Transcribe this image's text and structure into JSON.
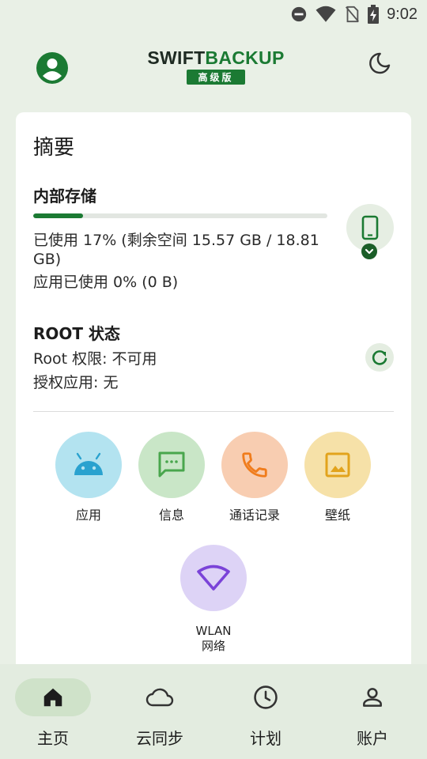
{
  "status_bar": {
    "time": "9:02",
    "icons": [
      "do-not-disturb-icon",
      "wifi-icon",
      "no-sim-icon",
      "battery-charging-icon"
    ]
  },
  "header": {
    "brand_part1": "SWIFT",
    "brand_part2": "BACKUP",
    "badge": "高级版",
    "left_icon": "account-circle-icon",
    "right_icon": "moon-icon"
  },
  "summary": {
    "title": "摘要",
    "storage": {
      "title": "内部存储",
      "used_fraction": 0.17,
      "used_line": "已使用 17% (剩余空间 15.57 GB / 18.81 GB)",
      "apps_line": "应用已使用 0% (0 B)"
    },
    "root": {
      "title": "ROOT 状态",
      "permission_line": "Root 权限: 不可用",
      "authorized_line": "授权应用: 无"
    }
  },
  "categories": [
    {
      "label": "应用",
      "icon": "android-icon",
      "color": "#b3e3f0"
    },
    {
      "label": "信息",
      "icon": "message-icon",
      "color": "#c9e6c7"
    },
    {
      "label": "通话记录",
      "icon": "phone-icon",
      "color": "#f8cdb1"
    },
    {
      "label": "壁纸",
      "icon": "image-icon",
      "color": "#f6e1a8"
    },
    {
      "label": "WLAN\n网络",
      "icon": "wifi-icon",
      "color": "#ddd3f6"
    }
  ],
  "bottom_nav": [
    {
      "label": "主页",
      "icon": "home-icon",
      "active": true
    },
    {
      "label": "云同步",
      "icon": "cloud-icon",
      "active": false
    },
    {
      "label": "计划",
      "icon": "clock-icon",
      "active": false
    },
    {
      "label": "账户",
      "icon": "person-icon",
      "active": false
    }
  ],
  "colors": {
    "brand_green": "#1b7a33",
    "background": "#e9f0e6"
  }
}
